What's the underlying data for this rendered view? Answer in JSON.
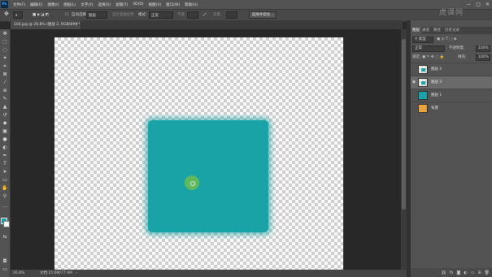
{
  "menubar": {
    "logo": "Ps",
    "items": [
      "文件(F)",
      "编辑(E)",
      "图像(I)",
      "图层(L)",
      "文字(Y)",
      "选择(S)",
      "滤镜(T)",
      "3D(D)",
      "视图(V)",
      "窗口(W)",
      "帮助(H)"
    ],
    "window_controls": [
      "—",
      "▢",
      "✕"
    ]
  },
  "optionsbar": {
    "auto_select_label": "自动选择：",
    "auto_select_value": "图层",
    "transform_controls_label": "显示变换控件",
    "mode_label": "模式：",
    "mode_value": "正常",
    "opacity_label": "不透",
    "flow_label": "流量",
    "select_subject_button": "选择并遮住..."
  },
  "document": {
    "tab_title": "104.jpg @ 26.8% (图层 2, RGB/8#) *",
    "close_icon": "✕"
  },
  "statusbar": {
    "zoom": "26.8%",
    "doc_info": "文档:15.6M/77.9M"
  },
  "layers_panel": {
    "tabs": [
      "图层",
      "通道",
      "路径",
      "历史记录"
    ],
    "active_tab": "图层",
    "filter_label": "类型",
    "blend_mode": "正常",
    "opacity_label": "不透明度:",
    "opacity_value": "100%",
    "lock_label": "锁定:",
    "fill_label": "填充:",
    "fill_value": "100%",
    "layers": [
      {
        "name": "图层 2",
        "visible": false,
        "selected": false,
        "thumb": "checker-teal"
      },
      {
        "name": "图层 3",
        "visible": true,
        "selected": true,
        "thumb": "checker-teal"
      },
      {
        "name": "图层 1",
        "visible": false,
        "selected": false,
        "thumb": "teal"
      },
      {
        "name": "背景",
        "visible": false,
        "selected": false,
        "thumb": "photo"
      }
    ],
    "footer_icons": [
      "link-icon",
      "fx-icon",
      "mask-icon",
      "adjustment-icon",
      "folder-icon",
      "new-layer-icon",
      "trash-icon"
    ]
  },
  "watermark": "虎课网",
  "colors": {
    "accent_teal": "#1aa3a6",
    "foreground": "#1aa3a6",
    "background": "#ffffff"
  }
}
